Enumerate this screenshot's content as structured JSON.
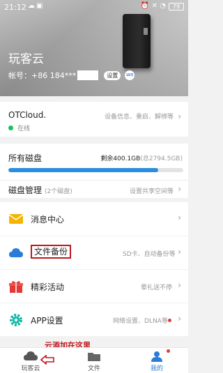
{
  "status_bar": {
    "time": "21:12",
    "battery": "79"
  },
  "header": {
    "title": "玩客云",
    "account_label": "帐号：+86 184***",
    "set_button": "设置",
    "level_badge": "LV3"
  },
  "device": {
    "name": "OTCloud.",
    "status": "在线",
    "hint": "设备信息、重启、解绑等"
  },
  "disks": {
    "title": "所有磁盘",
    "remaining": "剩余400.1GB",
    "total": "(总2794.5GB)",
    "used_fraction": 0.857
  },
  "disk_manage": {
    "title": "磁盘管理",
    "count": "(2个磁盘)",
    "hint": "设置共享空间等"
  },
  "menu": [
    {
      "label": "消息中心",
      "hint": ""
    },
    {
      "label": "文件备份",
      "hint": "SD卡、自动备份等"
    },
    {
      "label": "精彩活动",
      "hint": "晕礼送不停"
    },
    {
      "label": "APP设置",
      "hint": "网络设置、DLNA等"
    }
  ],
  "annotation": "云添加在这里",
  "tabs": [
    {
      "label": "玩客云"
    },
    {
      "label": "文件"
    },
    {
      "label": "我的"
    }
  ],
  "colors": {
    "accent": "#2a7cd8",
    "progress": "#2a8de0",
    "online": "#19c15b",
    "annotation": "#c0151b"
  }
}
